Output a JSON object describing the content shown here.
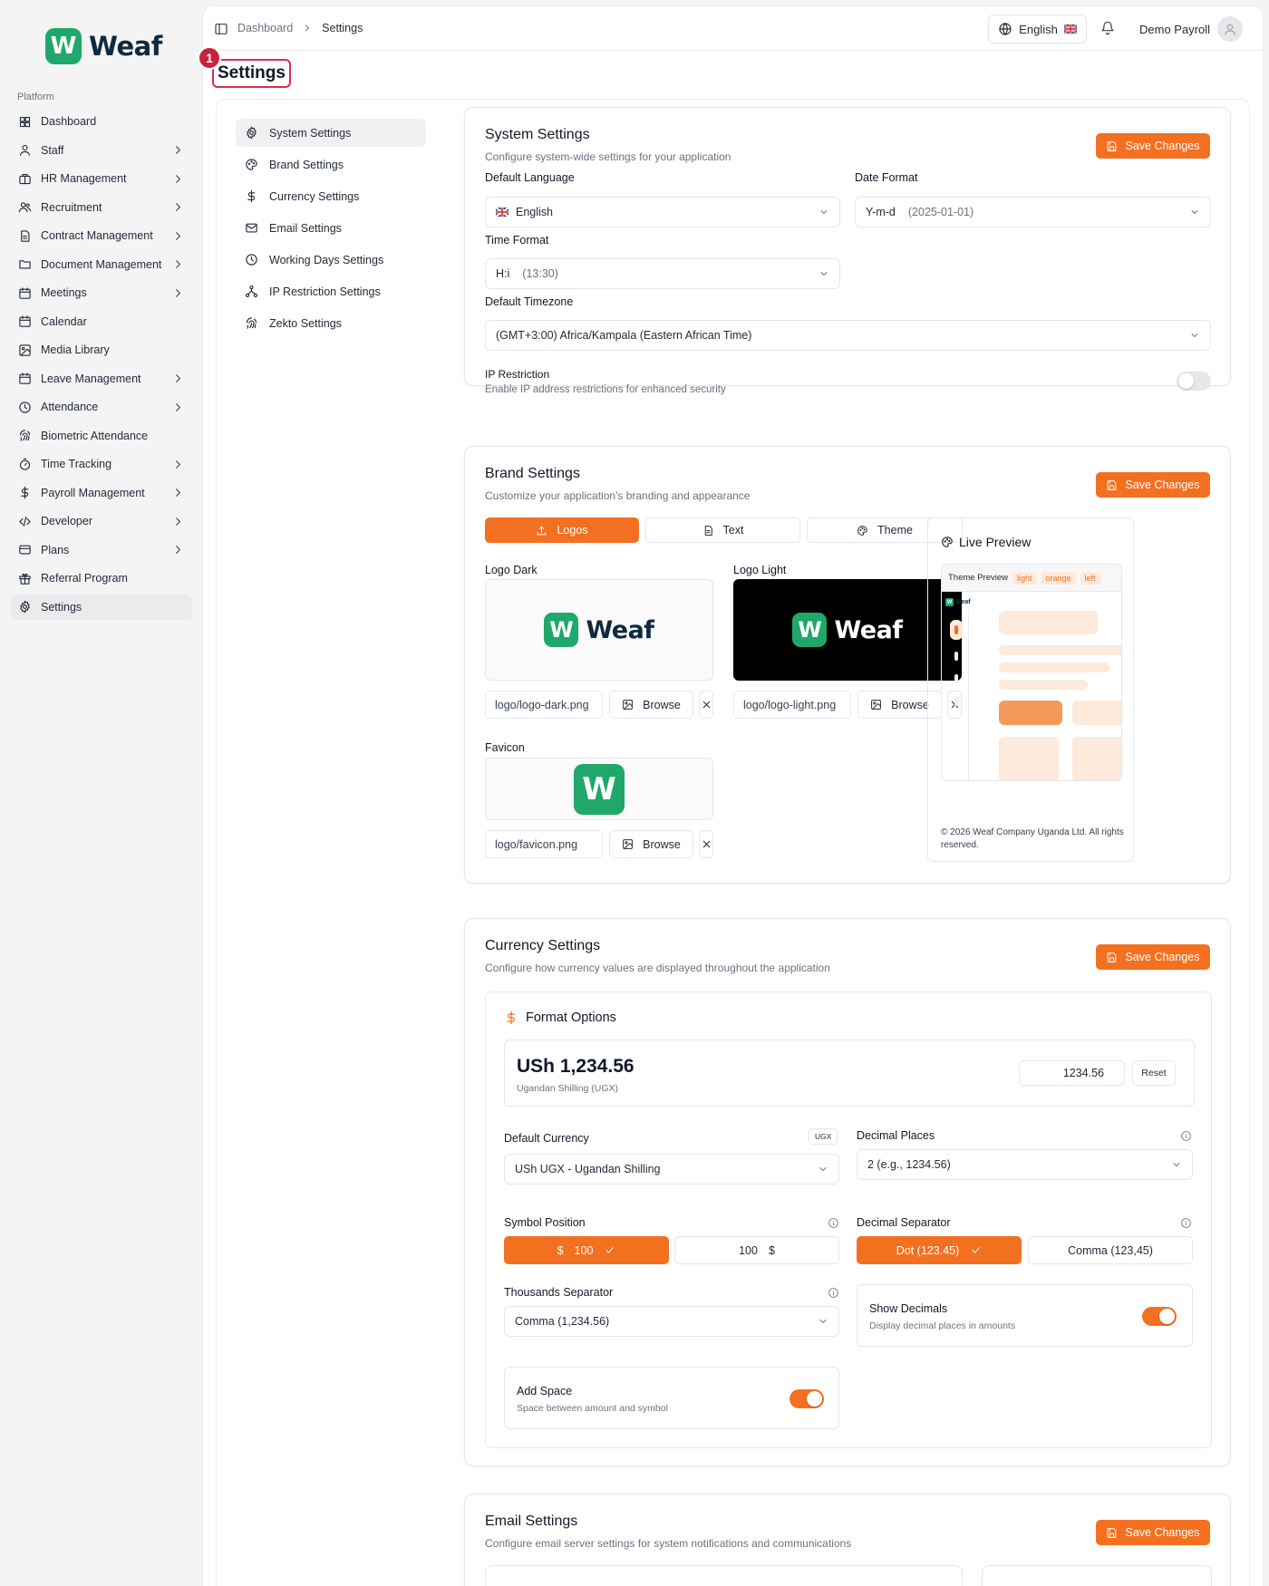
{
  "brand": {
    "badge": "W",
    "name": "Weaf"
  },
  "sidebar": {
    "section_label": "Platform",
    "items": [
      {
        "label": "Dashboard",
        "icon": "grid-icon",
        "chevron": false
      },
      {
        "label": "Staff",
        "icon": "user-icon",
        "chevron": true
      },
      {
        "label": "HR Management",
        "icon": "briefcase-icon",
        "chevron": true
      },
      {
        "label": "Recruitment",
        "icon": "users-icon",
        "chevron": true
      },
      {
        "label": "Contract Management",
        "icon": "file-icon",
        "chevron": true
      },
      {
        "label": "Document Management",
        "icon": "folder-icon",
        "chevron": true
      },
      {
        "label": "Meetings",
        "icon": "calendar-icon",
        "chevron": true
      },
      {
        "label": "Calendar",
        "icon": "calendar-icon",
        "chevron": false
      },
      {
        "label": "Media Library",
        "icon": "image-icon",
        "chevron": false
      },
      {
        "label": "Leave Management",
        "icon": "calendar-icon",
        "chevron": true
      },
      {
        "label": "Attendance",
        "icon": "clock-icon",
        "chevron": true
      },
      {
        "label": "Biometric Attendance",
        "icon": "fingerprint-icon",
        "chevron": false
      },
      {
        "label": "Time Tracking",
        "icon": "timer-icon",
        "chevron": true
      },
      {
        "label": "Payroll Management",
        "icon": "dollar-icon",
        "chevron": true
      },
      {
        "label": "Developer",
        "icon": "code-icon",
        "chevron": true
      },
      {
        "label": "Plans",
        "icon": "card-icon",
        "chevron": true
      },
      {
        "label": "Referral Program",
        "icon": "gift-icon",
        "chevron": false
      },
      {
        "label": "Settings",
        "icon": "gear-icon",
        "chevron": false,
        "active": true
      }
    ]
  },
  "topbar": {
    "breadcrumb": [
      "Dashboard",
      "Settings"
    ],
    "language": "English",
    "user_name": "Demo Payroll"
  },
  "page": {
    "title": "Settings",
    "step_badge": "1"
  },
  "subnav": [
    {
      "label": "System Settings",
      "icon": "gear-icon",
      "active": true
    },
    {
      "label": "Brand Settings",
      "icon": "palette-icon"
    },
    {
      "label": "Currency Settings",
      "icon": "dollar-icon"
    },
    {
      "label": "Email Settings",
      "icon": "mail-icon"
    },
    {
      "label": "Working Days Settings",
      "icon": "clock-icon"
    },
    {
      "label": "IP Restriction Settings",
      "icon": "network-icon"
    },
    {
      "label": "Zekto Settings",
      "icon": "fingerprint-icon"
    }
  ],
  "system": {
    "title": "System Settings",
    "subtitle": "Configure system-wide settings for your application",
    "save_label": "Save Changes",
    "default_language_label": "Default Language",
    "default_language_value": "English",
    "date_format_label": "Date Format",
    "date_format_value": "Y-m-d",
    "date_format_example": "(2025-01-01)",
    "time_format_label": "Time Format",
    "time_format_value": "H:i",
    "time_format_example": "(13:30)",
    "timezone_label": "Default Timezone",
    "timezone_value": "(GMT+3:00) Africa/Kampala (Eastern African Time)",
    "ip_title": "IP Restriction",
    "ip_sub": "Enable IP address restrictions for enhanced security",
    "ip_enabled": false
  },
  "brand_settings": {
    "title": "Brand Settings",
    "subtitle": "Customize your application's branding and appearance",
    "save_label": "Save Changes",
    "tabs": [
      "Logos",
      "Text",
      "Theme"
    ],
    "logo_dark_label": "Logo Dark",
    "logo_dark_path": "logo/logo-dark.png",
    "logo_light_label": "Logo Light",
    "logo_light_path": "logo/logo-light.png",
    "favicon_label": "Favicon",
    "favicon_path": "logo/favicon.png",
    "browse_label": "Browse",
    "preview_title": "Live Preview",
    "preview_bar_label": "Theme Preview",
    "preview_chips": [
      "light",
      "orange",
      "left"
    ],
    "preview_brand": "Weaf",
    "copyright": "© 2026 Weaf Company Uganda Ltd. All rights reserved."
  },
  "currency": {
    "title": "Currency Settings",
    "subtitle": "Configure how currency values are displayed throughout the application",
    "save_label": "Save Changes",
    "format_title": "Format Options",
    "preview_amount": "USh 1,234.56",
    "preview_currency_name": "Ugandan Shilling (UGX)",
    "sample_input": "1234.56",
    "reset_label": "Reset",
    "default_currency_label": "Default Currency",
    "currency_badge": "UGX",
    "default_currency_value": "USh UGX - Ugandan Shilling",
    "decimal_places_label": "Decimal Places",
    "decimal_places_value": "2 (e.g., 1234.56)",
    "symbol_position_label": "Symbol Position",
    "symbol_before": {
      "symbol": "$",
      "amount": "100"
    },
    "symbol_after": {
      "amount": "100",
      "symbol": "$"
    },
    "decimal_separator_label": "Decimal Separator",
    "decimal_dot": "Dot (123.45)",
    "decimal_comma": "Comma (123,45)",
    "thousands_label": "Thousands Separator",
    "thousands_value": "Comma (1,234.56)",
    "show_decimals_title": "Show Decimals",
    "show_decimals_sub": "Display decimal places in amounts",
    "add_space_title": "Add Space",
    "add_space_sub": "Space between amount and symbol"
  },
  "email": {
    "title": "Email Settings",
    "subtitle": "Configure email server settings for system notifications and communications",
    "save_label": "Save Changes"
  },
  "colors": {
    "accent": "#f37021",
    "brand_green": "#1fa86a",
    "badge_red": "#c5233b"
  }
}
